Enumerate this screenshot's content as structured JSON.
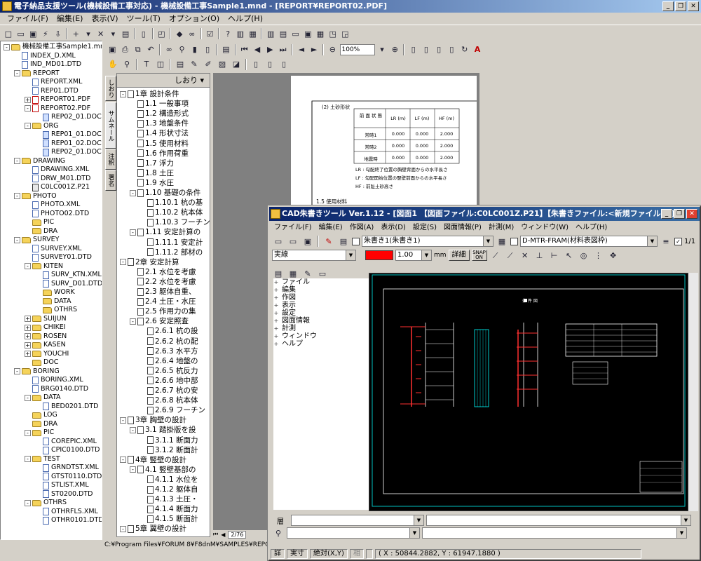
{
  "window": {
    "title": "電子納品支援ツール(機械設備工事対応) - 機械設備工事Sample1.mnd - [REPORT¥REPORT02.PDF]",
    "controls": [
      "_",
      "❐",
      "✕"
    ]
  },
  "menu": [
    "ファイル(F)",
    "編集(E)",
    "表示(V)",
    "ツール(T)",
    "オプション(O)",
    "ヘルプ(H)"
  ],
  "tree": [
    {
      "label": "機械設備工事Sample1.mnd",
      "indent": 0,
      "kind": "folder",
      "toggle": "-"
    },
    {
      "label": "INDEX_D.XML",
      "indent": 1,
      "kind": "xml"
    },
    {
      "label": "IND_MD01.DTD",
      "indent": 1,
      "kind": "xml"
    },
    {
      "label": "REPORT",
      "indent": 1,
      "kind": "folder",
      "toggle": "-"
    },
    {
      "label": "REPORT.XML",
      "indent": 2,
      "kind": "xml"
    },
    {
      "label": "REP01.DTD",
      "indent": 2,
      "kind": "xml"
    },
    {
      "label": "REPORT01.PDF",
      "indent": 2,
      "kind": "pdf",
      "toggle": "+"
    },
    {
      "label": "REPORT02.PDF",
      "indent": 2,
      "kind": "pdf",
      "toggle": "-"
    },
    {
      "label": "REP02_01.DOC",
      "indent": 3,
      "kind": "doc"
    },
    {
      "label": "ORG",
      "indent": 2,
      "kind": "folder",
      "toggle": "-"
    },
    {
      "label": "REP01_01.DOC",
      "indent": 3,
      "kind": "doc"
    },
    {
      "label": "REP01_02.DOC",
      "indent": 3,
      "kind": "doc"
    },
    {
      "label": "REP02_01.DOC",
      "indent": 3,
      "kind": "doc"
    },
    {
      "label": "DRAWING",
      "indent": 1,
      "kind": "folder",
      "toggle": "-"
    },
    {
      "label": "DRAWING.XML",
      "indent": 2,
      "kind": "xml"
    },
    {
      "label": "DRW_M01.DTD",
      "indent": 2,
      "kind": "xml"
    },
    {
      "label": "C0LC001Z.P21",
      "indent": 2,
      "kind": "p21"
    },
    {
      "label": "PHOTO",
      "indent": 1,
      "kind": "folder",
      "toggle": "-"
    },
    {
      "label": "PHOTO.XML",
      "indent": 2,
      "kind": "xml"
    },
    {
      "label": "PHOTO02.DTD",
      "indent": 2,
      "kind": "xml"
    },
    {
      "label": "PIC",
      "indent": 2,
      "kind": "folder"
    },
    {
      "label": "DRA",
      "indent": 2,
      "kind": "folder"
    },
    {
      "label": "SURVEY",
      "indent": 1,
      "kind": "folder",
      "toggle": "-"
    },
    {
      "label": "SURVEY.XML",
      "indent": 2,
      "kind": "xml"
    },
    {
      "label": "SURVEY01.DTD",
      "indent": 2,
      "kind": "xml"
    },
    {
      "label": "KITEN",
      "indent": 2,
      "kind": "folder",
      "toggle": "-"
    },
    {
      "label": "SURV_KTN.XML",
      "indent": 3,
      "kind": "xml"
    },
    {
      "label": "SURV_D01.DTD",
      "indent": 3,
      "kind": "xml"
    },
    {
      "label": "WORK",
      "indent": 3,
      "kind": "folder"
    },
    {
      "label": "DATA",
      "indent": 3,
      "kind": "folder"
    },
    {
      "label": "OTHRS",
      "indent": 3,
      "kind": "folder"
    },
    {
      "label": "SUIJUN",
      "indent": 2,
      "kind": "folder",
      "toggle": "+"
    },
    {
      "label": "CHIKEI",
      "indent": 2,
      "kind": "folder",
      "toggle": "+"
    },
    {
      "label": "ROSEN",
      "indent": 2,
      "kind": "folder",
      "toggle": "+"
    },
    {
      "label": "KASEN",
      "indent": 2,
      "kind": "folder",
      "toggle": "+"
    },
    {
      "label": "YOUCHI",
      "indent": 2,
      "kind": "folder",
      "toggle": "+"
    },
    {
      "label": "DOC",
      "indent": 2,
      "kind": "folder"
    },
    {
      "label": "BORING",
      "indent": 1,
      "kind": "folder",
      "toggle": "-"
    },
    {
      "label": "BORING.XML",
      "indent": 2,
      "kind": "xml"
    },
    {
      "label": "BRG0140.DTD",
      "indent": 2,
      "kind": "xml"
    },
    {
      "label": "DATA",
      "indent": 2,
      "kind": "folder",
      "toggle": "-"
    },
    {
      "label": "BED0201.DTD",
      "indent": 3,
      "kind": "xml"
    },
    {
      "label": "LOG",
      "indent": 2,
      "kind": "folder"
    },
    {
      "label": "DRA",
      "indent": 2,
      "kind": "folder"
    },
    {
      "label": "PIC",
      "indent": 2,
      "kind": "folder",
      "toggle": "-"
    },
    {
      "label": "COREPIC.XML",
      "indent": 3,
      "kind": "xml"
    },
    {
      "label": "CPIC0100.DTD",
      "indent": 3,
      "kind": "xml"
    },
    {
      "label": "TEST",
      "indent": 2,
      "kind": "folder",
      "toggle": "-"
    },
    {
      "label": "GRNDTST.XML",
      "indent": 3,
      "kind": "xml"
    },
    {
      "label": "GTST0110.DTD",
      "indent": 3,
      "kind": "xml"
    },
    {
      "label": "STLIST.XML",
      "indent": 3,
      "kind": "xml"
    },
    {
      "label": "ST0200.DTD",
      "indent": 3,
      "kind": "xml"
    },
    {
      "label": "OTHRS",
      "indent": 2,
      "kind": "folder",
      "toggle": "-"
    },
    {
      "label": "OTHRFLS.XML",
      "indent": 3,
      "kind": "xml"
    },
    {
      "label": "OTHR0101.DTD",
      "indent": 3,
      "kind": "xml"
    }
  ],
  "status_path": "C:¥Program Files¥FORUM 8¥F8dnM¥SAMPLES¥REPORT02.",
  "viewer": {
    "zoom": "100%",
    "page_indicator": "2/76"
  },
  "side_tabs": [
    "しおり",
    "サムネール",
    "注釈",
    "署名"
  ],
  "bookmarks": {
    "header": "しおり ▾",
    "items": [
      {
        "label": "1章 設計条件",
        "indent": 0,
        "toggle": "-"
      },
      {
        "label": "1.1 一般事項",
        "indent": 1
      },
      {
        "label": "1.2 構造形式",
        "indent": 1
      },
      {
        "label": "1.3 地盤条件",
        "indent": 1
      },
      {
        "label": "1.4 形状寸法",
        "indent": 1
      },
      {
        "label": "1.5 使用材料",
        "indent": 1
      },
      {
        "label": "1.6 作用荷重",
        "indent": 1
      },
      {
        "label": "1.7 浮力",
        "indent": 1
      },
      {
        "label": "1.8 土圧",
        "indent": 1
      },
      {
        "label": "1.9 水圧",
        "indent": 1
      },
      {
        "label": "1.10 基礎の条件",
        "indent": 1,
        "toggle": "-"
      },
      {
        "label": "1.10.1 杭の基",
        "indent": 2
      },
      {
        "label": "1.10.2 杭本体",
        "indent": 2
      },
      {
        "label": "1.10.3 フーチン",
        "indent": 2
      },
      {
        "label": "1.11 安定計算の",
        "indent": 1,
        "toggle": "-"
      },
      {
        "label": "1.11.1 安定計",
        "indent": 2
      },
      {
        "label": "1.11.2 部材の",
        "indent": 2
      },
      {
        "label": "2章 安定計算",
        "indent": 0,
        "toggle": "-"
      },
      {
        "label": "2.1 水位を考慮",
        "indent": 1
      },
      {
        "label": "2.2 水位を考慮",
        "indent": 1
      },
      {
        "label": "2.3 躯体自重、",
        "indent": 1
      },
      {
        "label": "2.4 土圧・水圧",
        "indent": 1
      },
      {
        "label": "2.5 作用力の集",
        "indent": 1
      },
      {
        "label": "2.6 安定照査",
        "indent": 1,
        "toggle": "-"
      },
      {
        "label": "2.6.1 杭の設",
        "indent": 2
      },
      {
        "label": "2.6.2 杭の配",
        "indent": 2
      },
      {
        "label": "2.6.3 水平方",
        "indent": 2
      },
      {
        "label": "2.6.4 地盤の",
        "indent": 2
      },
      {
        "label": "2.6.5 杭反力",
        "indent": 2
      },
      {
        "label": "2.6.6 地中部",
        "indent": 2
      },
      {
        "label": "2.6.7 杭の安",
        "indent": 2
      },
      {
        "label": "2.6.8 杭本体",
        "indent": 2
      },
      {
        "label": "2.6.9 フーチン",
        "indent": 2
      },
      {
        "label": "3章 胸壁の設計",
        "indent": 0,
        "toggle": "-"
      },
      {
        "label": "3.1 踏掛版を設",
        "indent": 1,
        "toggle": "-"
      },
      {
        "label": "3.1.1 断面力",
        "indent": 2
      },
      {
        "label": "3.1.2 断面計",
        "indent": 2
      },
      {
        "label": "4章 竪壁の設計",
        "indent": 0,
        "toggle": "-"
      },
      {
        "label": "4.1 竪壁基部の",
        "indent": 1,
        "toggle": "-"
      },
      {
        "label": "4.1.1 水位を",
        "indent": 2
      },
      {
        "label": "4.1.2 躯体自",
        "indent": 2
      },
      {
        "label": "4.1.3 土圧・",
        "indent": 2
      },
      {
        "label": "4.1.4 断面力",
        "indent": 2
      },
      {
        "label": "4.1.5 断面計",
        "indent": 2
      },
      {
        "label": "5章 翼壁の設計",
        "indent": 0,
        "toggle": "-"
      }
    ]
  },
  "pdf": {
    "page_number": "2",
    "section": "(2) 土砂形状",
    "table_headers": [
      "前 面 状 態",
      "LR (m)",
      "LF (m)",
      "HF (m)"
    ],
    "table_rows": [
      [
        "常時1",
        "0.000",
        "0.000",
        "2.000"
      ],
      [
        "常時2",
        "0.000",
        "0.000",
        "2.000"
      ],
      [
        "地震時",
        "0.000",
        "0.000",
        "2.000"
      ]
    ],
    "notes": [
      "LR : 勾配終了位置の胸壁背面からの水平長さ",
      "LF : 勾配開始位置の竪壁前面からの水平長さ",
      "HF : 前趾土砂高さ"
    ],
    "next_heading": "1.5 使用材料"
  },
  "cad": {
    "title": "CAD朱書きツール Ver.1.12 - [図面1 【図面ファイル:C0LC001Z.P21】【朱書きファイル:<新規ファイル>】]",
    "menu": [
      "ファイル(F)",
      "編集(E)",
      "作図(A)",
      "表示(D)",
      "設定(S)",
      "図面情報(P)",
      "計測(M)",
      "ウィンドウ(W)",
      "ヘルプ(H)"
    ],
    "layer_combo": "朱書き1(朱書き1)",
    "drawing_layer_combo": "D-MTR-FRAM(材料表図枠)",
    "right_value": "1/1",
    "line_type": "実線",
    "line_color": "#ff0000",
    "line_width": "1.00",
    "unit": "mm",
    "detail_button": "詳細",
    "snap_label": "SNAP ON",
    "tree": [
      "ファイル",
      "編集",
      "作図",
      "表示",
      "設定",
      "図面情報",
      "計測",
      "ウィンドウ",
      "ヘルプ"
    ],
    "canvas_label": "条 件 図",
    "bottom_label1": "層",
    "status": [
      "詳",
      "実寸",
      "絶対(X,Y)",
      "相",
      "",
      "( X : 50844.2882, Y : 61947.1880 )"
    ]
  }
}
